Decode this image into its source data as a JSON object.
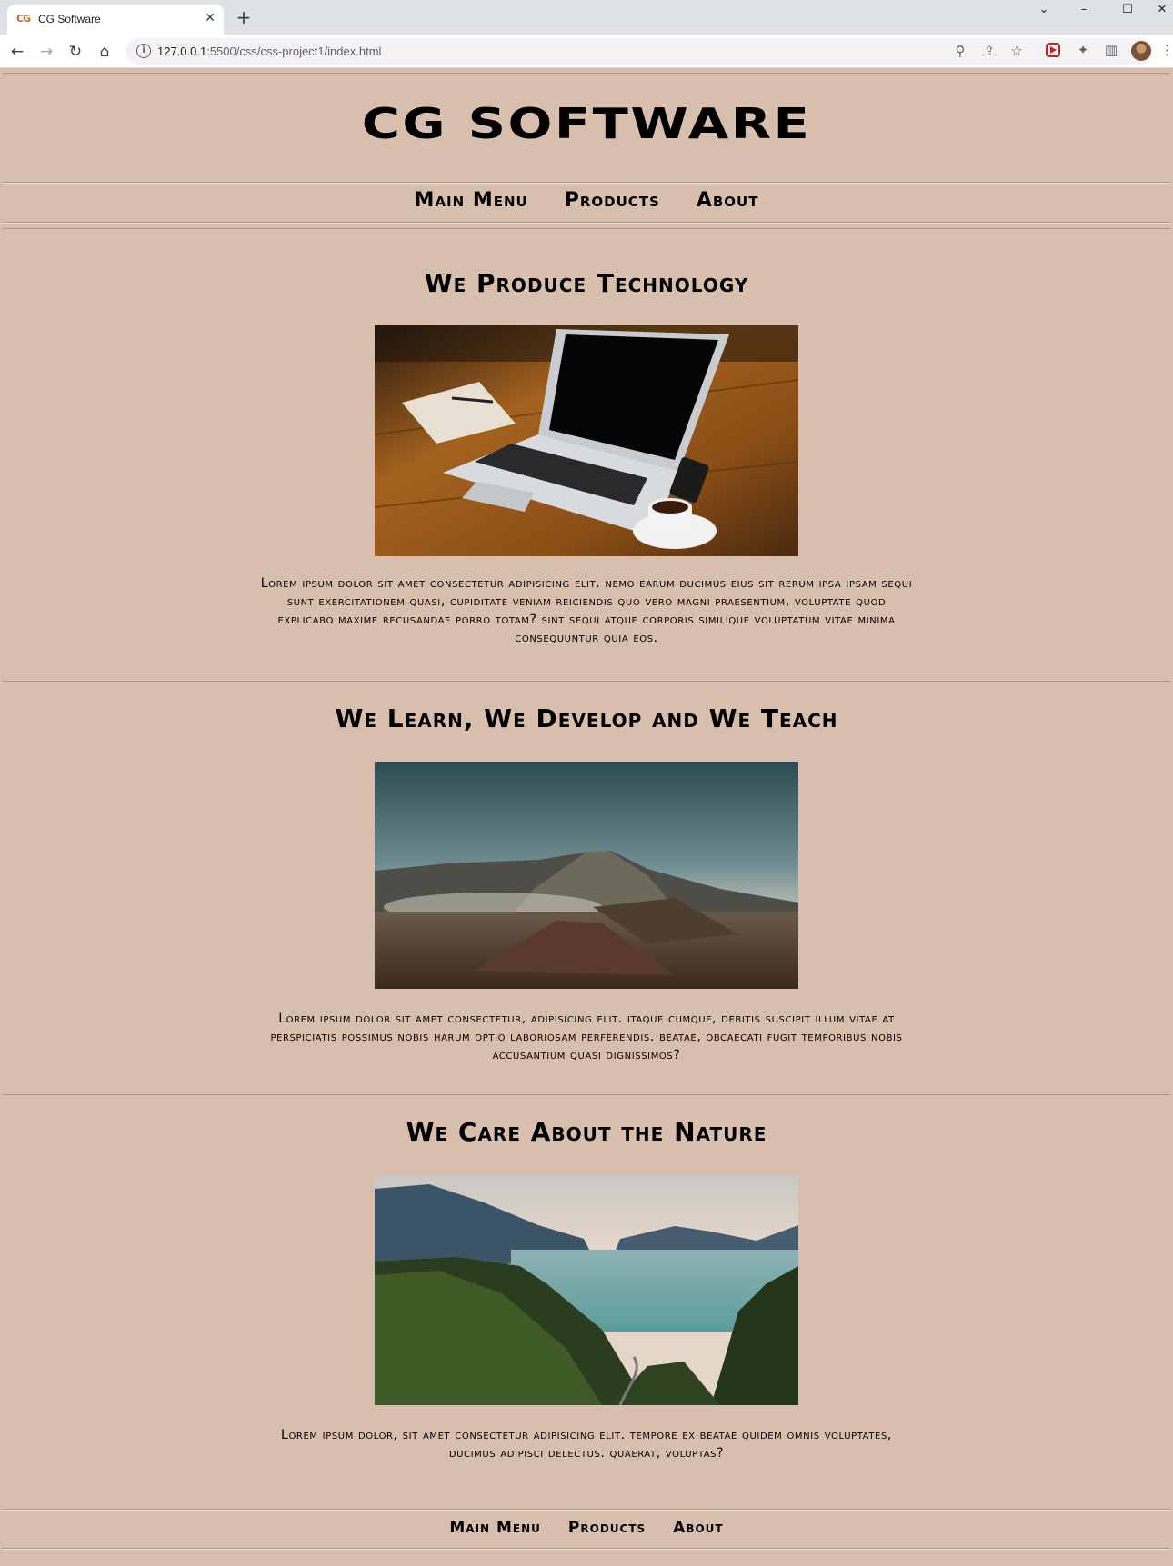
{
  "browser": {
    "tab_title": "CG Software",
    "tab_favicon_text": "CG",
    "url_host": "127.0.0.1",
    "url_path": ":5500/css/css-project1/index.html",
    "icons": {
      "back": "arrow-left-icon",
      "forward": "arrow-right-icon",
      "reload": "reload-icon",
      "home": "home-icon",
      "site_info": "info-icon",
      "zoom": "zoom-icon",
      "share": "share-icon",
      "bookmark": "star-icon",
      "extensions": "puzzle-icon",
      "side_panel": "side-panel-icon",
      "menu": "kebab-menu-icon"
    }
  },
  "header": {
    "site_title": "CG SOFTWARE"
  },
  "nav": {
    "items": [
      "Main Menu",
      "Products",
      "About"
    ]
  },
  "sections": [
    {
      "title": "We Produce Technology",
      "image_alt": "Laptop, notebook and coffee cup on a wooden table",
      "text": "Lorem ipsum dolor sit amet consectetur adipisicing elit. Nemo earum ducimus eius sit rerum ipsa ipsam sequi sunt exercitationem quasi, cupiditate veniam reiciendis quo vero magni praesentium, voluptate quod explicabo maxime recusandae porro totam? Sint sequi atque corporis similique voluptatum vitae minima consequuntur quia eos."
    },
    {
      "title": "We Learn, We Develop and We Teach",
      "image_alt": "Volcanic mountain landscape with smoke",
      "text": "Lorem ipsum dolor sit amet consectetur, adipisicing elit. Itaque cumque, debitis suscipit illum vitae at perspiciatis possimus nobis harum optio laboriosam perferendis. Beatae, obcaecati fugit temporibus nobis accusantium quasi dignissimos?"
    },
    {
      "title": "We Care About the Nature",
      "image_alt": "Lake surrounded by forested mountains",
      "text": "Lorem ipsum dolor, sit amet consectetur adipisicing elit. Tempore ex beatae quidem omnis voluptates, ducimus adipisci delectus. Quaerat, voluptas?"
    }
  ],
  "footer": {
    "items": [
      "Main Menu",
      "Products",
      "About"
    ]
  },
  "colors": {
    "page_background": "#d8bfad",
    "text": "#000000",
    "rule": "#a99888"
  }
}
